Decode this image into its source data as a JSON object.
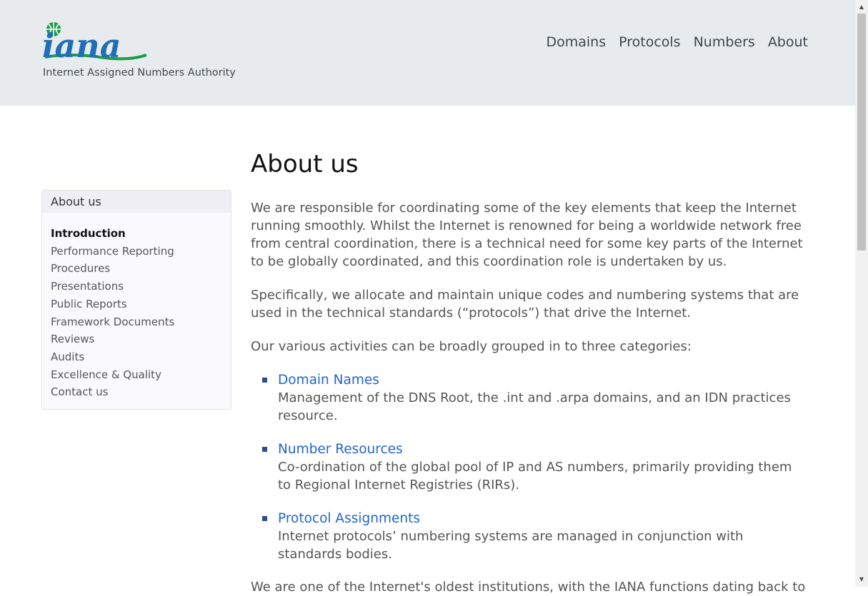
{
  "header": {
    "logo_text": "iana",
    "logo_subtitle": "Internet Assigned Numbers Authority",
    "nav": [
      "Domains",
      "Protocols",
      "Numbers",
      "About"
    ]
  },
  "sidebar": {
    "heading": "About us",
    "items": [
      "Introduction",
      "Performance Reporting",
      "Procedures",
      "Presentations",
      "Public Reports",
      "Framework Documents",
      "Reviews",
      "Audits",
      "Excellence & Quality",
      "Contact us"
    ],
    "active_item": "Introduction"
  },
  "main": {
    "title": "About us",
    "paragraphs": [
      "We are responsible for coordinating some of the key elements that keep the Internet running smoothly. Whilst the Internet is renowned for being a worldwide network free from central coordination, there is a technical need for some key parts of the Internet to be globally coordinated, and this coordination role is undertaken by us.",
      "Specifically, we allocate and maintain unique codes and numbering systems that are used in the technical standards (“protocols”) that drive the Internet.",
      "Our various activities can be broadly grouped in to three categories:"
    ],
    "categories": [
      {
        "title": "Domain Names",
        "description": "Management of the DNS Root, the .int and .arpa domains, and an IDN practices resource."
      },
      {
        "title": "Number Resources",
        "description": "Co-ordination of the global pool of IP and AS numbers, primarily providing them to Regional Internet Registries (RIRs)."
      },
      {
        "title": "Protocol Assignments",
        "description": "Internet protocols’ numbering systems are managed in conjunction with standards bodies."
      }
    ],
    "closing_partial": "We are one of the Internet's oldest institutions, with the IANA functions dating back to"
  },
  "colors": {
    "header_bg": "#e8ebed",
    "link": "#2266cc",
    "bullet": "#2f4c8c",
    "logo_blue": "#1f6fb8",
    "logo_green": "#1d9a4a"
  }
}
